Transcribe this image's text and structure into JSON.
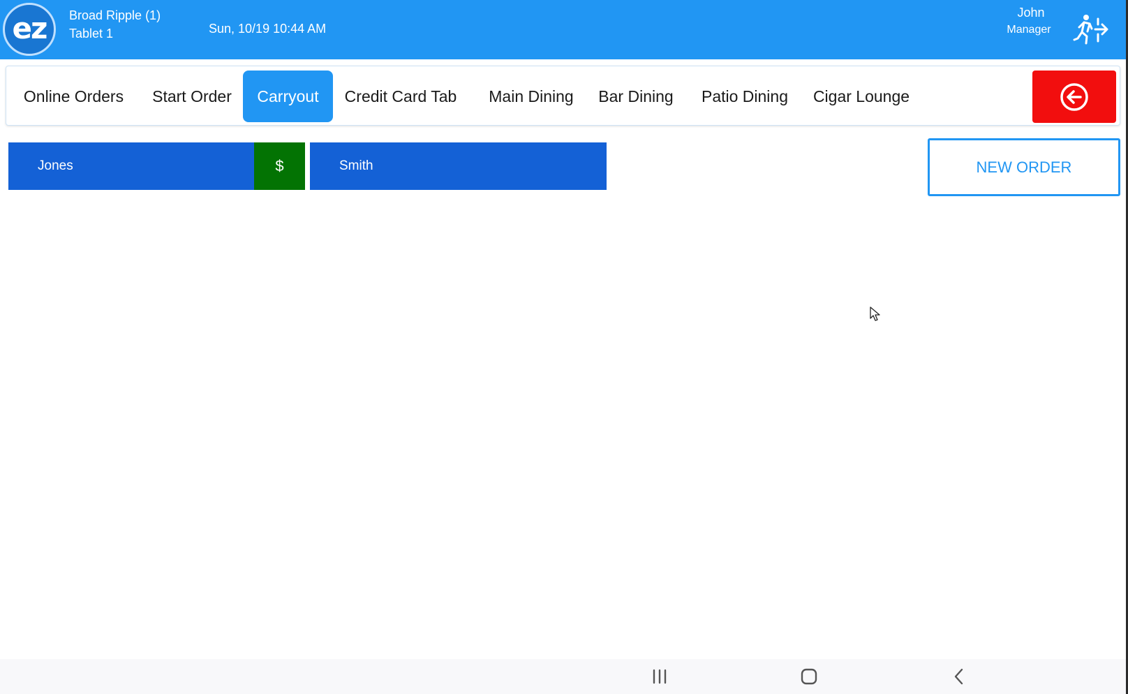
{
  "header": {
    "logo_text": "ez",
    "store_name": "Broad Ripple (1)",
    "device_name": "Tablet 1",
    "datetime": "Sun, 10/19 10:44 AM",
    "user_name": "John",
    "user_role": "Manager",
    "logout_icon": "exit-running-person-icon"
  },
  "tabs": [
    {
      "label": "Online Orders",
      "active": false
    },
    {
      "label": "Start Order",
      "active": false
    },
    {
      "label": "Carryout",
      "active": true
    },
    {
      "label": "Credit Card Tab",
      "active": false
    },
    {
      "label": "Main Dining",
      "active": false
    },
    {
      "label": "Bar Dining",
      "active": false
    },
    {
      "label": "Patio Dining",
      "active": false
    },
    {
      "label": "Cigar Lounge",
      "active": false
    }
  ],
  "back_button": {
    "icon": "arrow-left-circle-icon"
  },
  "orders": [
    {
      "name": "Jones",
      "paid_marker": "$"
    },
    {
      "name": "Smith"
    }
  ],
  "new_order_label": "NEW ORDER",
  "colors": {
    "header_blue": "#2196f3",
    "order_blue": "#1461d6",
    "paid_green": "#037303",
    "back_red": "#f20e0e"
  },
  "navbar": {
    "recent_icon": "recent-apps-icon",
    "home_icon": "home-icon",
    "back_icon": "back-chevron-icon"
  }
}
